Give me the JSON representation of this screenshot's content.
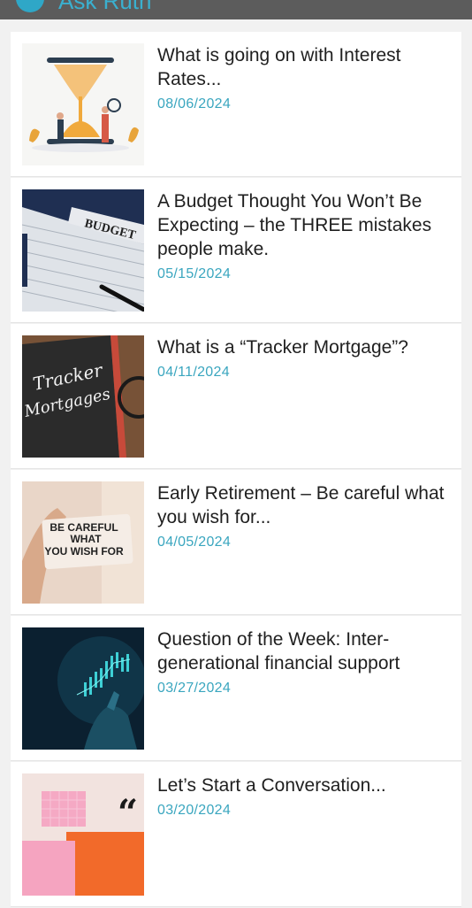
{
  "header": {
    "title": "Ask Ruth"
  },
  "posts": [
    {
      "title": "What is going on with Interest Rates...",
      "date": "08/06/2024",
      "image": "hourglass-illustration"
    },
    {
      "title": "A Budget Thought You Won’t Be Expecting – the THREE mistakes people make.",
      "date": "05/15/2024",
      "image": "budget-binder-photo"
    },
    {
      "title": "What is a “Tracker Mortgage”?",
      "date": "04/11/2024",
      "image": "tracker-mortgages-notebook-photo"
    },
    {
      "title": "Early Retirement – Be careful what you wish for...",
      "date": "04/05/2024",
      "image": "be-careful-card-photo",
      "image_text": [
        "BE CAREFUL",
        "WHAT",
        "YOU WISH FOR"
      ]
    },
    {
      "title": "Question of the Week: Inter-generational financial support",
      "date": "03/27/2024",
      "image": "hand-chart-photo"
    },
    {
      "title": "Let’s Start a Conversation...",
      "date": "03/20/2024",
      "image": "speech-bubble-illustration"
    }
  ],
  "thumb_texts": {
    "budget": "BUDGET",
    "tracker_line1": "Tracker",
    "tracker_line2": "Mortgages",
    "quote": "“"
  }
}
